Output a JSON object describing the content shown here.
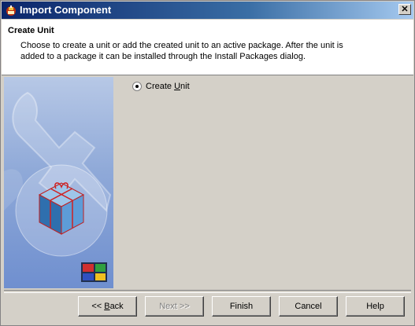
{
  "window": {
    "title": "Import Component",
    "close_glyph": "✕"
  },
  "header": {
    "heading": "Create Unit",
    "description": "Choose to create a unit or add the created unit to an active package. After the unit is added to a package it can be installed through the Install Packages dialog."
  },
  "options": {
    "create_unit": {
      "label_pre": "Create ",
      "label_access": "U",
      "label_post": "nit",
      "selected": true
    }
  },
  "buttons": {
    "back": {
      "pre": "<< ",
      "access": "B",
      "post": "ack"
    },
    "next": "Next >>",
    "finish": "Finish",
    "cancel": "Cancel",
    "help": "Help"
  },
  "colors": {
    "title_bar_start": "#0a246a",
    "dialog_face": "#d4d0c8",
    "side_panel": "#8fa9d8"
  },
  "icons": {
    "app": "delphi-helmet-icon",
    "side_art": "wrench-and-package-graphic",
    "logo": "four-color-squares-logo"
  }
}
